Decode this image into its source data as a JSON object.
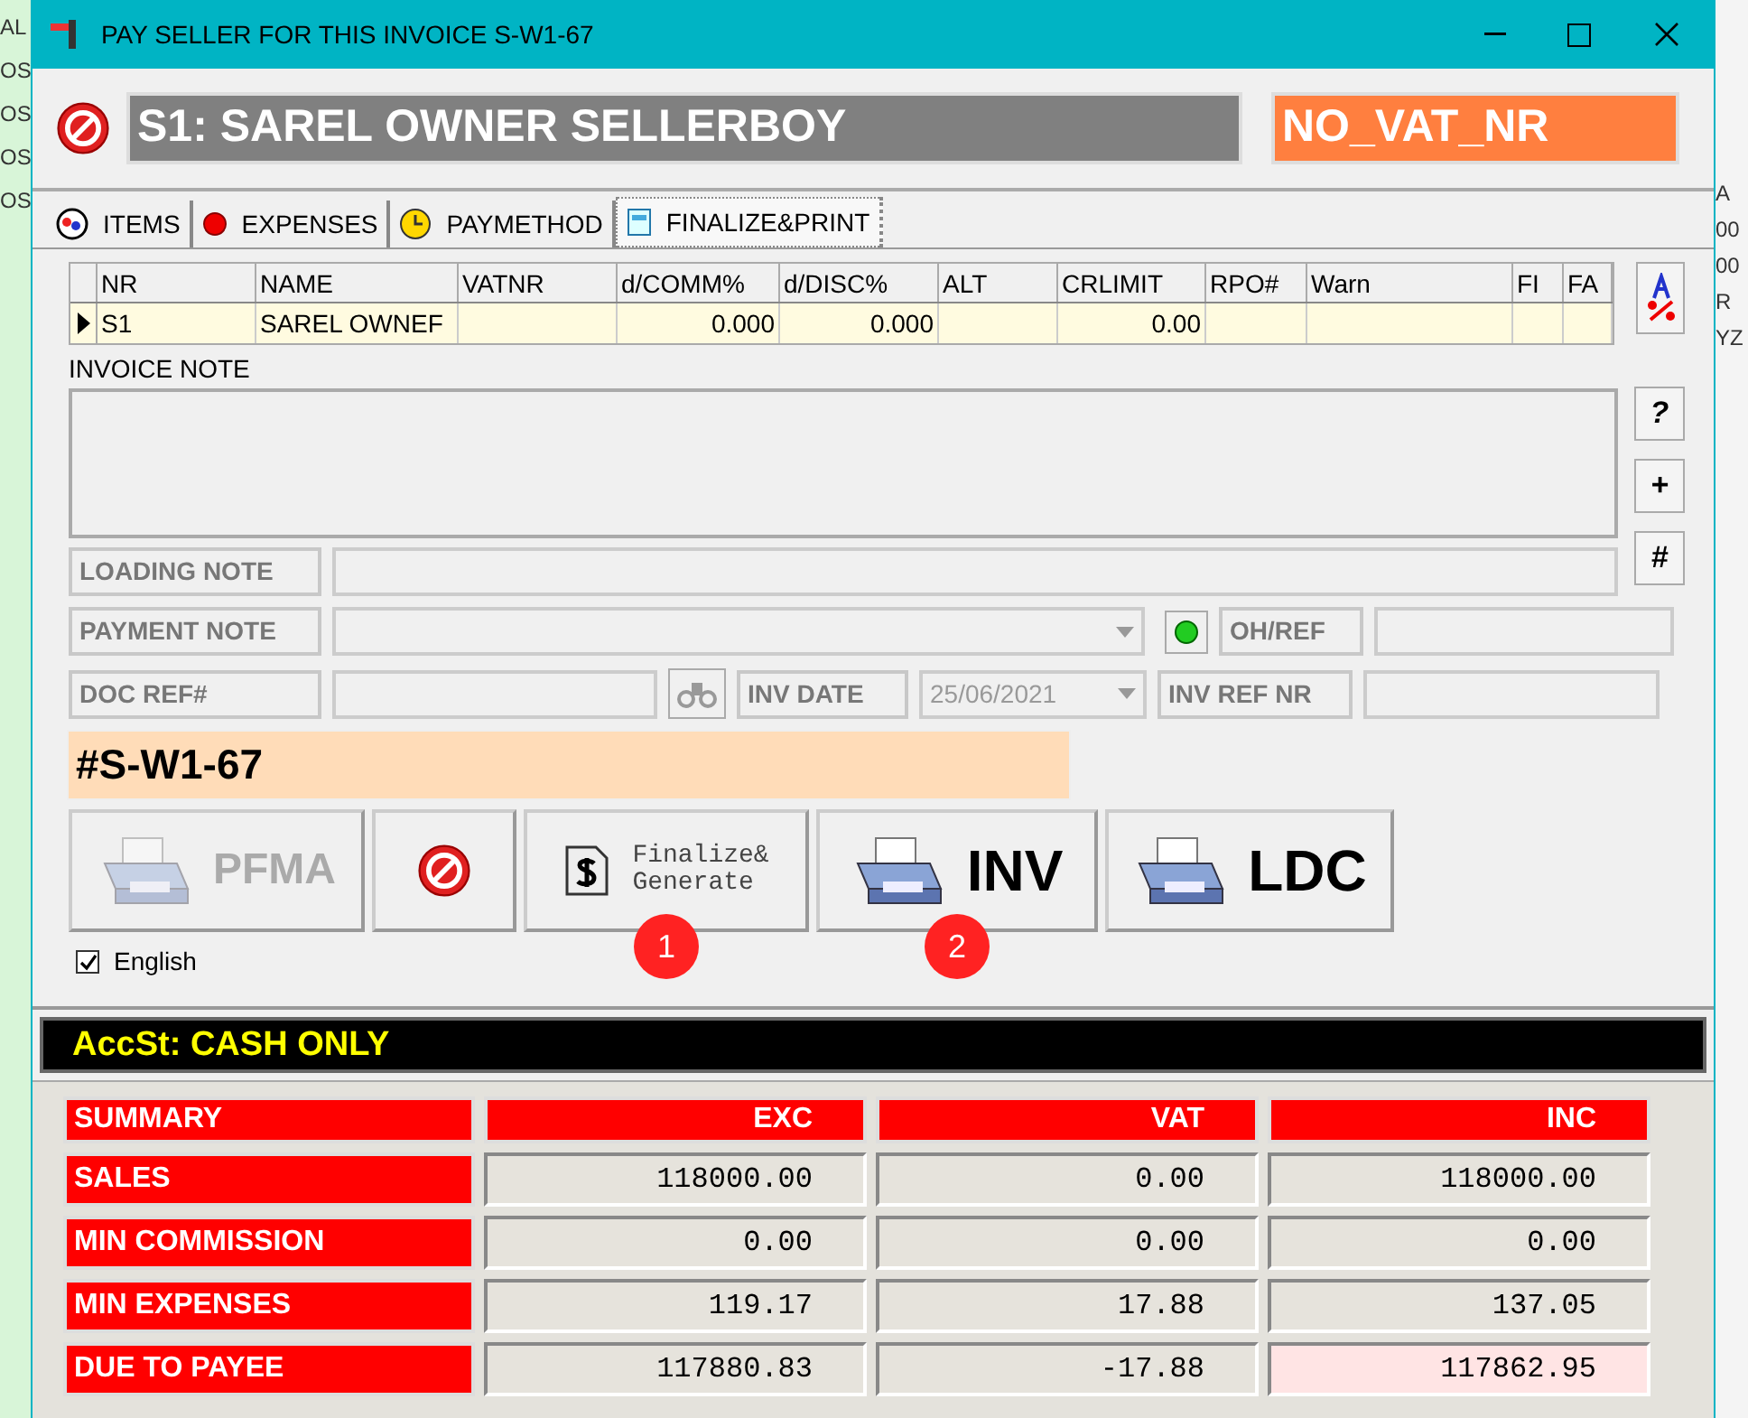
{
  "background": {
    "left_fragments": [
      "AL",
      "OS",
      "OS",
      "OS",
      "OS"
    ],
    "right_fragments": [
      "A",
      "00",
      "00",
      "R",
      "YZ"
    ]
  },
  "window": {
    "title": "PAY SELLER FOR THIS INVOICE S-W1-67"
  },
  "header": {
    "seller": "S1: SAREL OWNER SELLERBOY",
    "vat_status": "NO_VAT_NR"
  },
  "tabs": [
    {
      "label": "ITEMS",
      "selected": false,
      "kind": "items"
    },
    {
      "label": "EXPENSES",
      "selected": false,
      "kind": "expenses"
    },
    {
      "label": "PAYMETHOD",
      "selected": false,
      "kind": "paymethod"
    },
    {
      "label": "FINALIZE&PRINT",
      "selected": true,
      "kind": "finalize"
    }
  ],
  "grid": {
    "columns": [
      "NR",
      "NAME",
      "VATNR",
      "d/COMM%",
      "d/DISC%",
      "ALT",
      "CRLIMIT",
      "RPO#",
      "Warn",
      "FI",
      "FA"
    ],
    "rows": [
      [
        "S1",
        "SAREL OWNEF",
        "",
        "0.000",
        "0.000",
        "",
        "0.00",
        "",
        "",
        "",
        ""
      ]
    ]
  },
  "side_buttons": [
    "?",
    "+",
    "#"
  ],
  "invoice_note": {
    "label": "INVOICE NOTE"
  },
  "loading_note": {
    "label": "LOADING NOTE"
  },
  "payment_note": {
    "label": "PAYMENT NOTE"
  },
  "oh_ref": {
    "label": "OH/REF",
    "light_on": true
  },
  "doc_ref": {
    "label": "DOC REF#"
  },
  "inv_date": {
    "label": "INV DATE",
    "value": "25/06/2021",
    "disabled": true
  },
  "inv_ref_nr": {
    "label": "INV REF NR"
  },
  "invoice_number": "#S-W1-67",
  "actions": [
    {
      "kind": "pfma",
      "label": "PFMA",
      "disabled": true
    },
    {
      "kind": "cancel"
    },
    {
      "kind": "finalize",
      "label": "Finalize&\nGenerate",
      "badge": "1"
    },
    {
      "kind": "inv",
      "label": "INV",
      "badge": "2"
    },
    {
      "kind": "ldc",
      "label": "LDC"
    }
  ],
  "language": {
    "label": "English",
    "checked": true
  },
  "account_status": "AccSt: CASH ONLY",
  "summary": {
    "columns": [
      "SUMMARY",
      "EXC",
      "VAT",
      "INC"
    ],
    "rows": [
      {
        "label": "SALES",
        "values": [
          "118000.00",
          "0.00",
          "118000.00"
        ],
        "highlight": false
      },
      {
        "label": "MIN COMMISSION",
        "values": [
          "0.00",
          "0.00",
          "0.00"
        ],
        "highlight": false
      },
      {
        "label": "MIN EXPENSES",
        "values": [
          "119.17",
          "17.88",
          "137.05"
        ],
        "highlight": false
      },
      {
        "label": "DUE TO PAYEE",
        "values": [
          "117880.83",
          "-17.88",
          "117862.95"
        ],
        "highlight": true
      }
    ]
  }
}
